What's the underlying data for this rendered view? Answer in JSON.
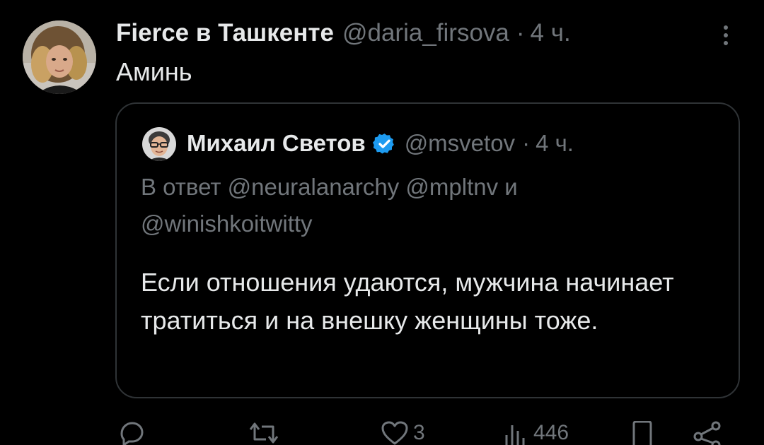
{
  "tweet": {
    "author_name": "Fierce в Ташкенте",
    "author_handle": "@daria_firsova",
    "separator": "·",
    "time": "4 ч.",
    "text": "Аминь"
  },
  "quote": {
    "author_name": "Михаил Светов",
    "author_handle": "@msvetov",
    "separator": "·",
    "time": "4 ч.",
    "reply_to": "В ответ @neuralanarchy @mpltnv и @winishkoitwitty",
    "text": "Если отношения удаются, мужчина начинает тратиться и на внешку женщины тоже."
  },
  "actions": {
    "replies": "",
    "retweets": "",
    "likes": "3",
    "views": "446"
  },
  "colors": {
    "background": "#000000",
    "text_primary": "#e7e9ea",
    "text_secondary": "#71767b",
    "border": "#2f3336",
    "verified": "#1d9bf0"
  },
  "icons": [
    "more-icon",
    "verified-badge-icon",
    "reply-icon",
    "retweet-icon",
    "like-icon",
    "views-icon",
    "bookmark-icon",
    "share-icon"
  ]
}
